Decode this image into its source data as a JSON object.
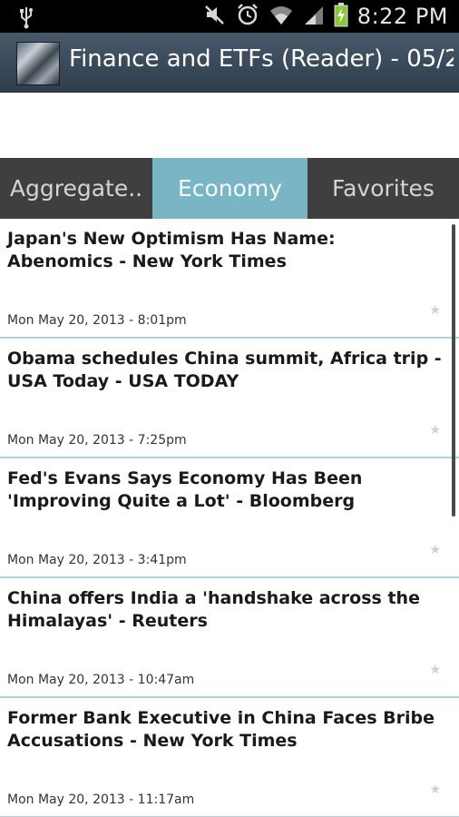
{
  "status_bar": {
    "time": "8:22 PM",
    "icons": [
      "usb-icon",
      "mute-icon",
      "alarm-icon",
      "wifi-icon",
      "signal-icon",
      "battery-charging-icon"
    ]
  },
  "action_bar": {
    "title": "Finance and ETFs (Reader) - 05/2..",
    "icon": "app-logo-icon"
  },
  "tabs": [
    {
      "label": "Aggregate..",
      "selected": false
    },
    {
      "label": "Economy",
      "selected": true
    },
    {
      "label": "Favorites",
      "selected": false
    }
  ],
  "colors": {
    "tab_selected": "#7ab5c6",
    "tab_bg": "#3f3f3f",
    "divider": "#a9d4e0",
    "action_bar": "#3d4b5a"
  },
  "articles": [
    {
      "title": "Japan's New Optimism Has Name: Abenomics - New York Times",
      "date": "Mon May 20, 2013 - 8:01pm"
    },
    {
      "title": "Obama schedules China summit, Africa trip - USA Today - USA TODAY",
      "date": "Mon May 20, 2013 - 7:25pm"
    },
    {
      "title": "Fed's Evans Says Economy Has Been 'Improving Quite a Lot' - Bloomberg",
      "date": "Mon May 20, 2013 - 3:41pm"
    },
    {
      "title": "China offers India a 'handshake across the Himalayas' - Reuters",
      "date": "Mon May 20, 2013 - 10:47am"
    },
    {
      "title": "Former Bank Executive in China Faces Bribe Accusations - New York Times",
      "date": "Mon May 20, 2013 - 11:17am"
    }
  ]
}
